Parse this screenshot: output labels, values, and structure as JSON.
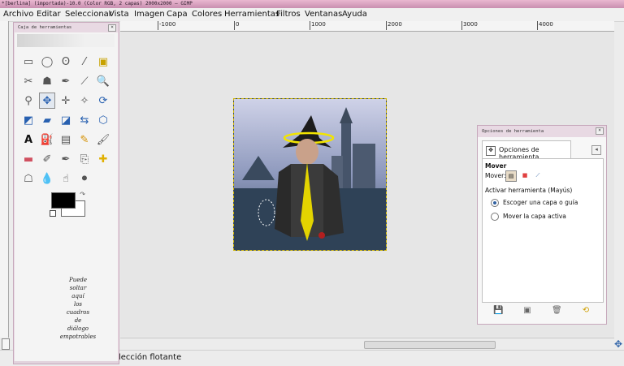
{
  "window": {
    "title": "*[berlina] (importada)-10.0 (Color RGB, 2 capas) 2000x2000 – GIMP"
  },
  "menu": [
    "Archivo",
    "Editar",
    "Seleccionar",
    "Vista",
    "Imagen",
    "Capa",
    "Colores",
    "Herramientas",
    "Filtros",
    "Ventanas",
    "Ayuda"
  ],
  "ruler": {
    "top_labels": [
      "-1000",
      "0",
      "1000",
      "2000",
      "3000",
      "4000"
    ]
  },
  "toolbox": {
    "title": "Caja de herramientas",
    "close": "×",
    "drop_hint": [
      "Puede",
      "soltar",
      "aquí",
      "los",
      "cuadros",
      "de",
      "diálogo",
      "empotrables"
    ]
  },
  "tool_options": {
    "window_title": "Opciones de herramienta",
    "close": "×",
    "tab_label": "Opciones de herramienta",
    "section_title": "Mover",
    "mover_label": "Mover:",
    "activate_label": "Activar herramienta (Mayús)",
    "option_pick": "Escoger una capa o guía",
    "option_active": "Mover la capa activa"
  },
  "statusbar": {
    "text": "lección flotante"
  },
  "colors": {
    "accent": "#c6a8bb",
    "selection": "#d4b800",
    "foreground": "#000000",
    "background": "#ffffff"
  }
}
